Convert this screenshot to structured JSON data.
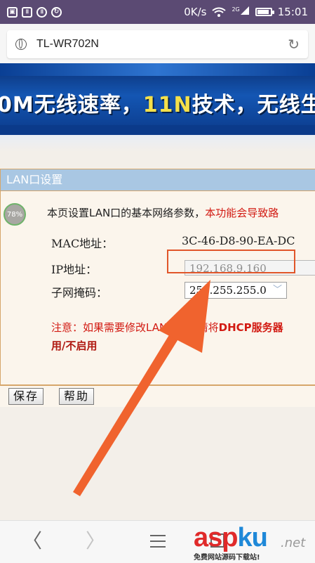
{
  "status_bar": {
    "speed": "0K/s",
    "network": "2G",
    "time": "15:01",
    "icons": [
      "image-icon",
      "pause-icon",
      "pause-icon",
      "sync-icon",
      "wifi-icon",
      "signal-icon",
      "battery-icon"
    ]
  },
  "browser": {
    "url_title": "TL-WR702N",
    "reload_glyph": "↻"
  },
  "banner": {
    "part1": "0M无线速率，",
    "part2": "11N",
    "part3": "技术，无线生"
  },
  "panel": {
    "title": "LAN口设置",
    "progress_badge": "78%",
    "description": "本页设置LAN口的基本网络参数，",
    "description_warn": "本功能会导致路",
    "mac_label": "MAC地址：",
    "mac_value": "3C-46-D8-90-EA-DC",
    "ip_label": "IP地址：",
    "ip_value": "192.168.9.160",
    "mask_label": "子网掩码：",
    "mask_value": "255.255.255.0",
    "note_prefix": "注意：如果需要修改LAN口IP，请将",
    "note_bold": "DHCP服务器",
    "note_line2": "用/不启用"
  },
  "buttons": {
    "save": "保存",
    "help": "帮助"
  },
  "nav": {
    "back": "〈",
    "forward": "〉"
  },
  "watermark": {
    "brand_a": "asp",
    "brand_k": "k",
    "brand_u": "u",
    "tld": ".net",
    "sub": "免费网站源码下载站!"
  },
  "colors": {
    "status_bar": "#5b4a73",
    "panel_title": "#a9c7e3",
    "warning_red": "#d21a12",
    "highlight_orange": "#e1562a"
  }
}
